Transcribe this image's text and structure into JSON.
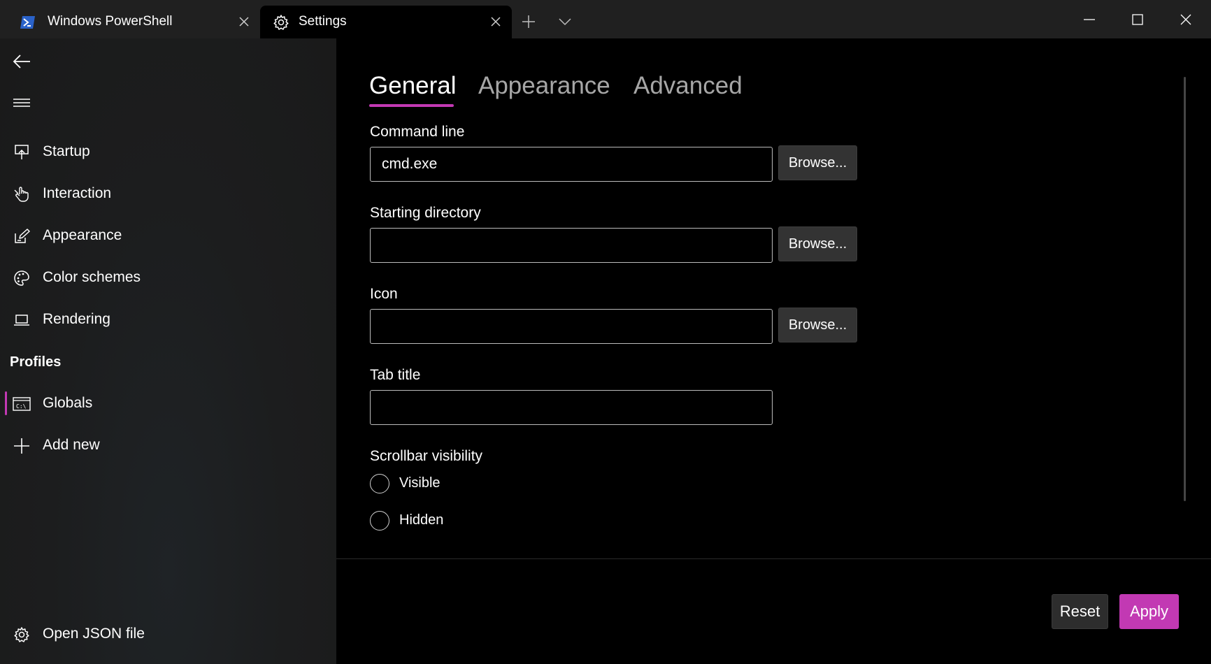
{
  "window": {
    "tabs": [
      {
        "label": "Windows PowerShell",
        "icon": "powershell-icon"
      },
      {
        "label": "Settings",
        "icon": "gear-icon"
      }
    ]
  },
  "sidebar": {
    "items": [
      {
        "label": "Startup",
        "icon": "startup-icon"
      },
      {
        "label": "Interaction",
        "icon": "hand-pointer-icon"
      },
      {
        "label": "Appearance",
        "icon": "pen-edit-icon"
      },
      {
        "label": "Color schemes",
        "icon": "palette-icon"
      },
      {
        "label": "Rendering",
        "icon": "laptop-icon"
      }
    ],
    "section_header": "Profiles",
    "profiles": [
      {
        "label": "Globals",
        "icon": "terminal-icon",
        "selected": true
      },
      {
        "label": "Add new",
        "icon": "plus-icon"
      }
    ],
    "footer_item": {
      "label": "Open JSON file",
      "icon": "gear-icon"
    }
  },
  "main": {
    "tabs": [
      {
        "label": "General",
        "active": true
      },
      {
        "label": "Appearance",
        "active": false
      },
      {
        "label": "Advanced",
        "active": false
      }
    ],
    "fields": {
      "command_line": {
        "label": "Command line",
        "value": "cmd.exe",
        "button": "Browse..."
      },
      "starting_directory": {
        "label": "Starting directory",
        "value": "",
        "button": "Browse..."
      },
      "icon": {
        "label": "Icon",
        "value": "",
        "button": "Browse..."
      },
      "tab_title": {
        "label": "Tab title",
        "value": ""
      }
    },
    "scrollbar_visibility": {
      "label": "Scrollbar visibility",
      "options": [
        "Visible",
        "Hidden"
      ],
      "selected": null
    },
    "footer": {
      "reset_label": "Reset",
      "apply_label": "Apply"
    }
  },
  "colors": {
    "accent": "#c239b3",
    "titlebar": "#202020",
    "sidebar": "#1c1d1e",
    "content": "#000000"
  }
}
